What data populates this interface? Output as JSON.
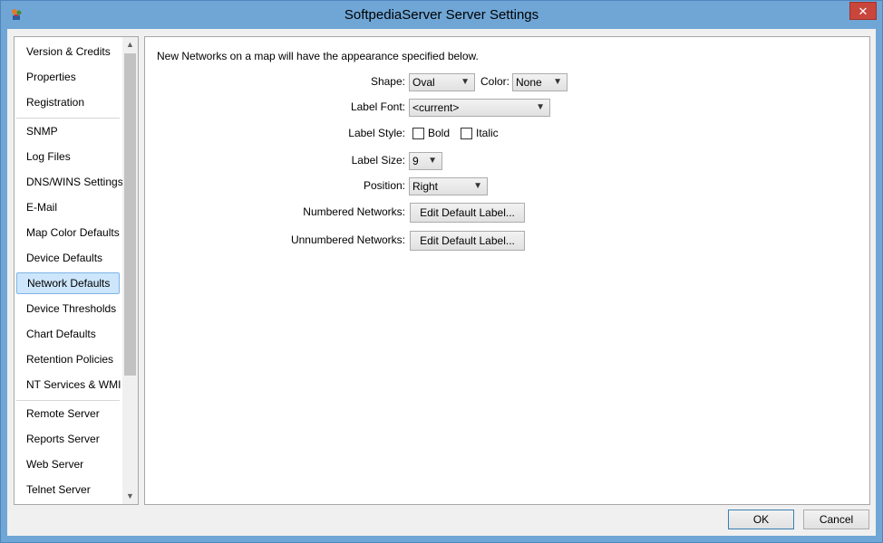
{
  "window": {
    "title": "SoftpediaServer Server Settings",
    "close_glyph": "✕"
  },
  "sidebar": {
    "items": [
      {
        "label": "Version & Credits",
        "group": 1
      },
      {
        "label": "Properties",
        "group": 1
      },
      {
        "label": "Registration",
        "group": 1
      },
      {
        "label": "SNMP",
        "group": 2
      },
      {
        "label": "Log Files",
        "group": 2
      },
      {
        "label": "DNS/WINS Settings",
        "group": 2
      },
      {
        "label": "E-Mail",
        "group": 2
      },
      {
        "label": "Map Color Defaults",
        "group": 2
      },
      {
        "label": "Device Defaults",
        "group": 2
      },
      {
        "label": "Network Defaults",
        "group": 2,
        "selected": true
      },
      {
        "label": "Device Thresholds",
        "group": 2
      },
      {
        "label": "Chart Defaults",
        "group": 2
      },
      {
        "label": "Retention Policies",
        "group": 2
      },
      {
        "label": "NT Services & WMI",
        "group": 2
      },
      {
        "label": "Remote Server",
        "group": 3
      },
      {
        "label": "Reports Server",
        "group": 3
      },
      {
        "label": "Web Server",
        "group": 3
      },
      {
        "label": "Telnet Server",
        "group": 3
      }
    ],
    "scroll_up_glyph": "▲",
    "scroll_down_glyph": "▼"
  },
  "main": {
    "intro": "New Networks on a map will have the appearance specified below.",
    "shape_label": "Shape:",
    "shape_value": "Oval",
    "color_label": "Color:",
    "color_value": "None",
    "label_font_label": "Label Font:",
    "label_font_value": "<current>",
    "label_style_label": "Label Style:",
    "bold_label": "Bold",
    "italic_label": "Italic",
    "label_size_label": "Label Size:",
    "label_size_value": "9",
    "position_label": "Position:",
    "position_value": "Right",
    "numbered_label": "Numbered Networks:",
    "numbered_button": "Edit Default Label...",
    "unnumbered_label": "Unnumbered Networks:",
    "unnumbered_button": "Edit Default Label...",
    "combo_arrow": "▼"
  },
  "footer": {
    "ok_label": "OK",
    "cancel_label": "Cancel"
  }
}
